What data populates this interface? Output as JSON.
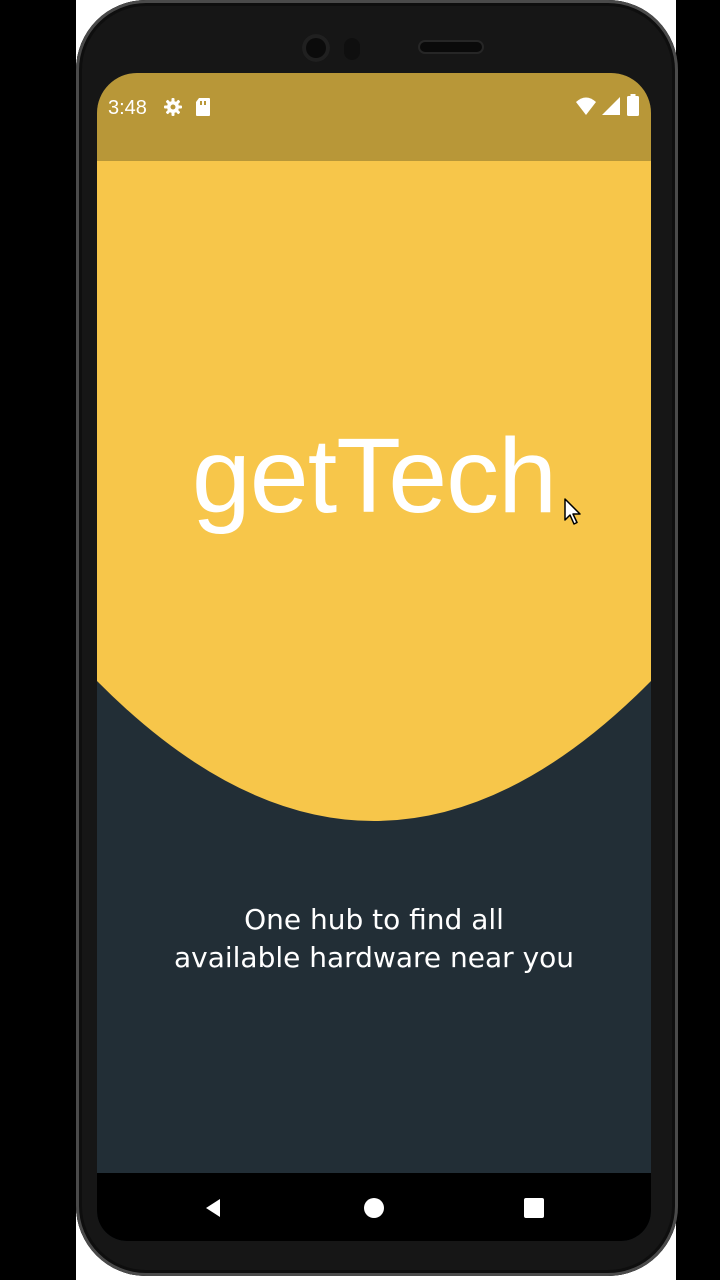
{
  "status_bar": {
    "time": "3:48",
    "icons": [
      "settings-icon",
      "sim-card-icon",
      "wifi-icon",
      "signal-icon",
      "battery-icon"
    ]
  },
  "app": {
    "title": "getTech",
    "tagline_line1": "One hub to find all",
    "tagline_line2": "available hardware near you"
  },
  "nav_bar": {
    "buttons": [
      "back-icon",
      "home-icon",
      "recents-icon"
    ]
  },
  "colors": {
    "status_bar": "#b89738",
    "hero_yellow": "#f7c64a",
    "background_dark": "#222e36",
    "text": "#ffffff"
  }
}
